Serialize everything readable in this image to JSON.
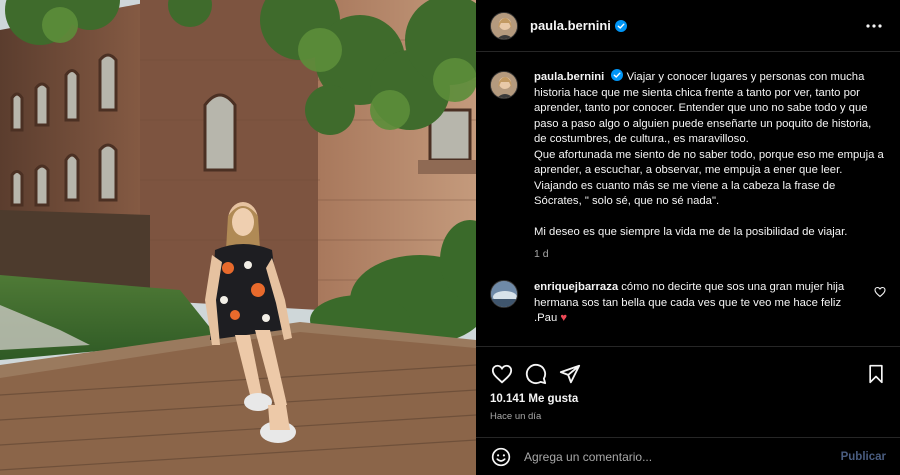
{
  "post": {
    "username": "paula.bernini",
    "verified": true,
    "more_icon": "more-horizontal-icon"
  },
  "caption": {
    "username": "paula.bernini",
    "lines": [
      "Viajar y conocer lugares y personas con mucha historia hace que me sienta chica frente a tanto por ver, tanto por aprender, tanto por conocer. Entender que uno no sabe todo y que paso a paso algo o alguien puede enseñarte un poquito de historia, de costumbres, de cultura., es maravilloso.",
      "Que afortunada me siento de no saber todo, porque eso me empuja a aprender, a escuchar, a observar, me empuja a ener que leer.",
      "Viajando es cuanto más se me viene a la cabeza la frase de Sócrates, \" solo sé, que no sé nada\".",
      "Mi deseo es que siempre la vida me de la posibilidad de viajar."
    ],
    "age": "1 d"
  },
  "reply": {
    "username": "enriquejbarraza",
    "text": "cómo no decirte que sos una gran mujer hija hermana sos tan bella que cada ves que te veo me hace feliz .Pau",
    "emoji": "♥"
  },
  "actions": {
    "like_icon": "heart-icon",
    "comment_icon": "comment-icon",
    "share_icon": "send-icon",
    "save_icon": "bookmark-icon",
    "likes_label": "10.141 Me gusta",
    "posted_ago": "Hace un día"
  },
  "comment_form": {
    "placeholder": "Agrega un comentario...",
    "publish_label": "Publicar",
    "emoji_icon": "smiley-icon"
  },
  "colors": {
    "background": "#000000",
    "text": "#f5f5f5",
    "muted": "#a8a8a8",
    "verified": "#0095f6",
    "publish": "#4a5d80",
    "heart": "#ed4956"
  }
}
